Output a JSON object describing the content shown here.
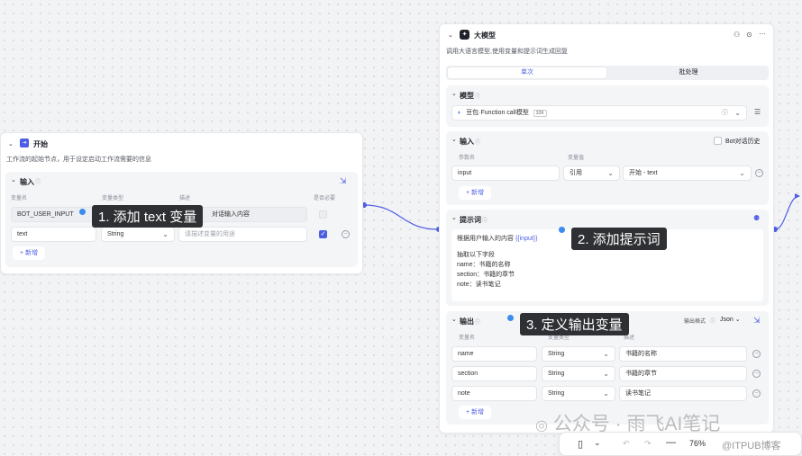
{
  "start_node": {
    "title": "开始",
    "description": "工作流的起始节点，用于设定启动工作流需要的信息",
    "input_section": {
      "title": "输入",
      "columns": [
        "变量名",
        "变量类型",
        "描述",
        "是否必要"
      ],
      "rows": [
        {
          "name": "BOT_USER_INPUT",
          "type": "",
          "desc": "对话输入内容"
        },
        {
          "name": "text",
          "type": "String",
          "desc_placeholder": "请描述变量的用途"
        }
      ],
      "add_label": "+ 新增"
    }
  },
  "llm_node": {
    "title": "大模型",
    "description": "调用大语言模型,使用变量和提示词生成回复",
    "tabs": [
      "单次",
      "批处理"
    ],
    "model_section": {
      "title": "模型",
      "model_name": "豆包·Function call模型",
      "context_badge": "32K"
    },
    "input_section": {
      "title": "输入",
      "history_label": "Bot对话历史",
      "columns": [
        "参数名",
        "变量值"
      ],
      "rows": [
        {
          "name": "input",
          "ref_type": "引用",
          "value": "开始 - text"
        }
      ],
      "add_label": "+ 新增"
    },
    "prompt_section": {
      "title": "提示词",
      "lines": [
        "根据用户输入的内容",
        "{{input}}",
        "抽取以下字段",
        "name：书籍的名称",
        "section：书籍的章节",
        "note：读书笔记"
      ]
    },
    "output_section": {
      "title": "输出",
      "format_label": "输出格式",
      "format_value": "Json",
      "columns": [
        "变量名",
        "变量类型",
        "描述"
      ],
      "rows": [
        {
          "name": "name",
          "type": "String",
          "desc": "书籍的名称"
        },
        {
          "name": "section",
          "type": "String",
          "desc": "书籍的章节"
        },
        {
          "name": "note",
          "type": "String",
          "desc": "读书笔记"
        }
      ],
      "add_label": "+ 新增"
    }
  },
  "callouts": {
    "step1": "1. 添加 text 变量",
    "step2": "2. 添加提示词",
    "step3": "3. 定义输出变量"
  },
  "toolbar": {
    "zoom": "76%"
  },
  "watermarks": {
    "main": "公众号 · 雨飞AI笔记",
    "sub": "@ITPUB博客"
  },
  "colors": {
    "accent": "#4e5ee4",
    "callout_bg": "#2f3033",
    "dot": "#3b8cf0"
  }
}
